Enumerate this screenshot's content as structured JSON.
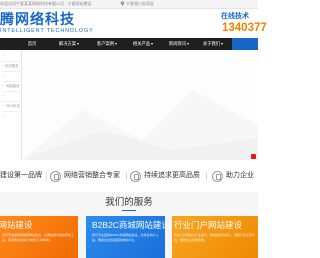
{
  "topbar": {
    "welcome": "欢迎访问宁夏某某网络科技有限公司 - 宁夏网站建设",
    "location": "宁夏银川金凤区",
    "location_icon": "map-pin-icon"
  },
  "header": {
    "logo_cn": "腾网络科技",
    "logo_en": "INTELLIGENT TECHNOLOGY",
    "hotline_label": "在线技术",
    "hotline_number": "1340377",
    "brand_color": "#1868c9",
    "accent_color": "#f08300"
  },
  "nav": {
    "items": [
      {
        "label": "首页",
        "caret": false,
        "active": false
      },
      {
        "label": "解决方案",
        "caret": true,
        "active": false
      },
      {
        "label": "客户案例",
        "caret": true,
        "active": false
      },
      {
        "label": "相关产品",
        "caret": true,
        "active": false
      },
      {
        "label": "新闻资讯",
        "caret": true,
        "active": false
      },
      {
        "label": "关于我们",
        "caret": true,
        "active": false
      },
      {
        "label": "",
        "caret": false,
        "active": true
      }
    ]
  },
  "banner": {
    "dropdown_items": [
      "···",
      "一站式服务",
      "···",
      "··· 网站建设",
      "···",
      "··· SEO优化",
      "···"
    ],
    "indicator_color": "#e11a1a"
  },
  "features": [
    {
      "icon": "badge-icon",
      "label": "建设第一品牌"
    },
    {
      "icon": "rocket-icon",
      "label": "网络营销整合专家"
    },
    {
      "icon": "medal-icon",
      "label": "持续追求更高品质"
    },
    {
      "icon": "handshake-icon",
      "label": "助力企业"
    }
  ],
  "services": {
    "title": "我们的服务",
    "cards": [
      {
        "title": "型网站建设",
        "desc": "我们专业提供营销型网站建设，让网站成为您的营销工具，获得更多的客户询盘与订单转化。"
      },
      {
        "title": "B2B2C商城网站建设",
        "desc": "我们专业提供B2B2C商城网站建设，支持多商户入驻，帮助企业快速搭建电商平台。"
      },
      {
        "title": "行业门户网站建设",
        "desc": "行业门户网站以行业资讯、供求信息为核心，搭建行业交流平台，帮助企业拓展市场。"
      }
    ]
  }
}
